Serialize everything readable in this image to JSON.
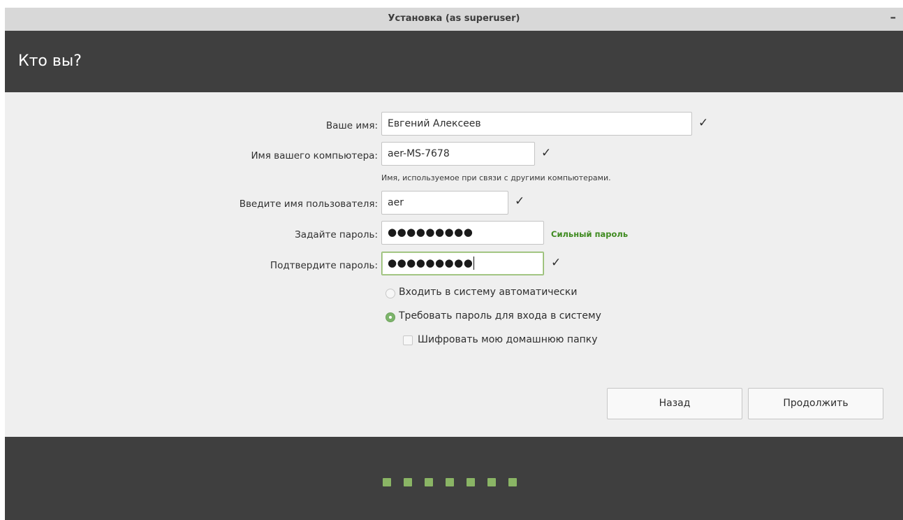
{
  "window": {
    "title": "Установка (as superuser)",
    "minimize_glyph": "–"
  },
  "header": {
    "title": "Кто вы?"
  },
  "form": {
    "name_label": "Ваше имя:",
    "name_value": "Евгений Алексеев",
    "computer_label": "Имя вашего компьютера:",
    "computer_value": "aer-MS-7678",
    "computer_hint": "Имя, используемое при связи с другими компьютерами.",
    "username_label": "Введите имя пользователя:",
    "username_value": "aer",
    "password_label": "Задайте пароль:",
    "password_value": "●●●●●●●●●",
    "password_strength": "Сильный пароль",
    "confirm_label": "Подтвердите пароль:",
    "confirm_value": "●●●●●●●●●",
    "check_glyph": "✓"
  },
  "options": {
    "auto_login": "Входить в систему автоматически",
    "require_password": "Требовать пароль для входа в систему",
    "encrypt_home": "Шифровать мою домашнюю папку",
    "selected": "require_password",
    "encrypt_checked": false
  },
  "buttons": {
    "back": "Назад",
    "continue": "Продолжить"
  },
  "progress": {
    "total_steps": 7,
    "completed_steps": 7
  },
  "colors": {
    "accent": "#8ab565",
    "header_bg": "#3f3f3f",
    "strength_text": "#3f8b20"
  }
}
